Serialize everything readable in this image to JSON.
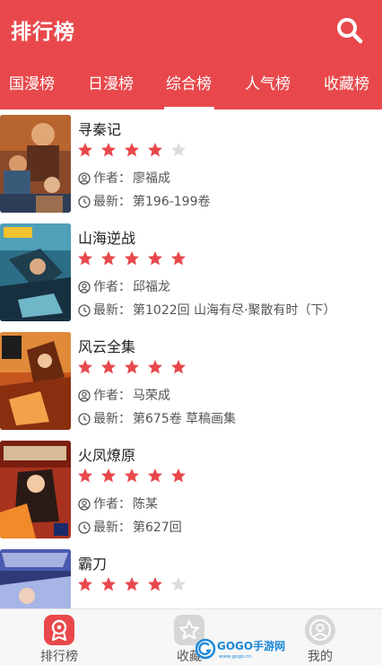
{
  "header": {
    "title": "排行榜",
    "tabs": [
      "国漫榜",
      "日漫榜",
      "综合榜",
      "人气榜",
      "收藏榜"
    ],
    "active_tab": "综合榜"
  },
  "labels": {
    "author": "作者：",
    "latest": "最新："
  },
  "comics": [
    {
      "name": "寻秦记",
      "rating": 4,
      "author": "廖福成",
      "latest": "第196-199卷"
    },
    {
      "name": "山海逆战",
      "rating": 5,
      "author": "邱福龙",
      "latest": "第1022回 山海有尽·聚散有时（下）"
    },
    {
      "name": "风云全集",
      "rating": 5,
      "author": "马荣成",
      "latest": "第675卷 草稿画集"
    },
    {
      "name": "火凤燎原",
      "rating": 5,
      "author": "陈某",
      "latest": "第627回"
    },
    {
      "name": "霸刀",
      "rating": 4
    }
  ],
  "bottom_nav": [
    {
      "label": "排行榜",
      "icon": "ranking-icon",
      "active": true
    },
    {
      "label": "收藏",
      "icon": "favorite-icon",
      "active": false
    },
    {
      "label": "我的",
      "icon": "profile-icon",
      "active": false
    }
  ],
  "watermark": {
    "brand": "GOGO手游网",
    "site": "www.gogo.cn"
  },
  "colors": {
    "accent": "#e8484b",
    "star_filled": "#e8484b",
    "star_empty": "#dddddd"
  }
}
